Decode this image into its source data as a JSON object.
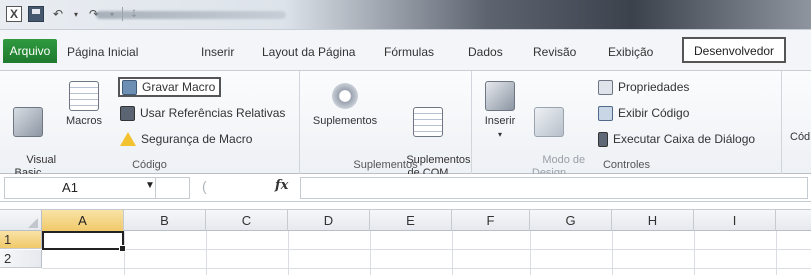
{
  "quick_access": {
    "icons": [
      "excel-icon",
      "save-icon",
      "undo-icon",
      "redo-icon",
      "customize-icon"
    ]
  },
  "tabs": [
    {
      "label": "Arquivo"
    },
    {
      "label": "Página Inicial"
    },
    {
      "label": "Inserir"
    },
    {
      "label": "Layout da Página"
    },
    {
      "label": "Fórmulas"
    },
    {
      "label": "Dados"
    },
    {
      "label": "Revisão"
    },
    {
      "label": "Exibição"
    },
    {
      "label": "Desenvolvedor"
    }
  ],
  "active_tab": "Desenvolvedor",
  "ribbon": {
    "codigo": {
      "label": "Código",
      "visual_basic": "Visual\nBasic",
      "macros": "Macros",
      "gravar_macro": "Gravar Macro",
      "usar_referencias": "Usar Referências Relativas",
      "seguranca_macro": "Segurança de Macro"
    },
    "suplementos": {
      "label": "Suplementos",
      "suplementos_btn": "Suplementos",
      "suplementos_com": "Suplementos\nde COM"
    },
    "controles": {
      "label": "Controles",
      "inserir": "Inserir",
      "modo_design": "Modo de\nDesign",
      "propriedades": "Propriedades",
      "exibir_codigo": "Exibir Código",
      "executar_caixa": "Executar Caixa de Diálogo"
    },
    "xml_partial": "Cód"
  },
  "formula_bar": {
    "name_box": "A1",
    "fx_label": "fx",
    "formula": ""
  },
  "grid": {
    "columns": [
      "A",
      "B",
      "C",
      "D",
      "E",
      "F",
      "G",
      "H",
      "I"
    ],
    "rows": [
      "1",
      "2"
    ],
    "active_cell": "A1"
  },
  "colors": {
    "file_tab": "#1f7a2d",
    "selected_header": "#f0c96a",
    "highlight_border": "#555555"
  }
}
